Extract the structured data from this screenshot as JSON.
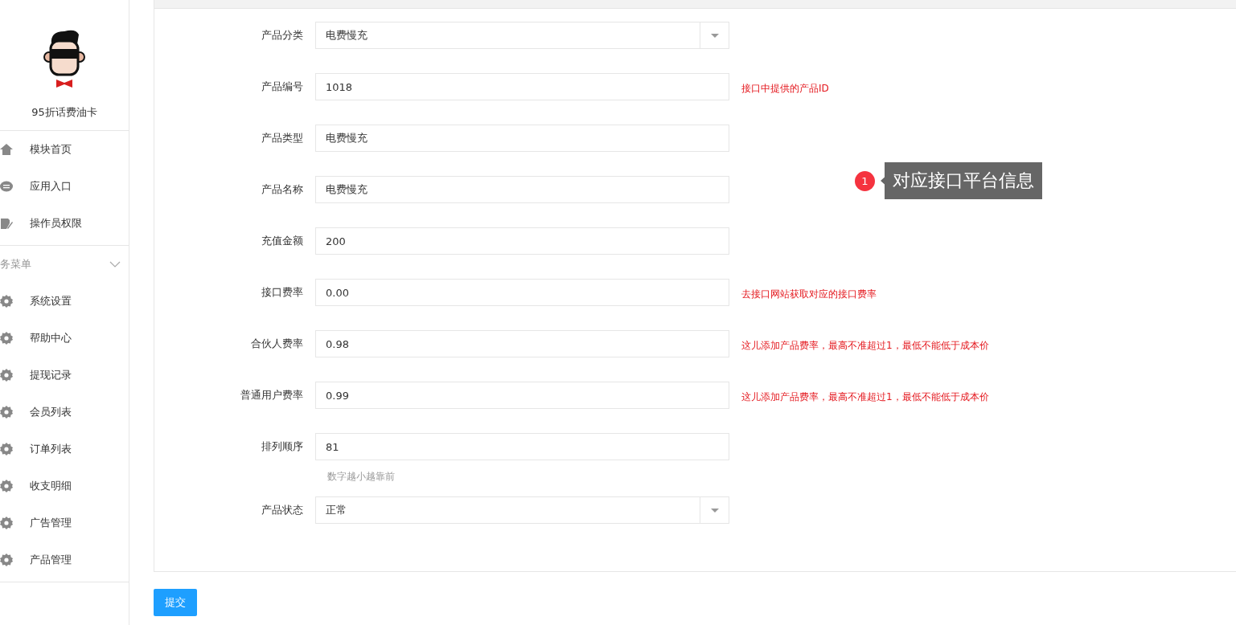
{
  "sidebar": {
    "brand": "95折话费油卡",
    "items": [
      {
        "label": "模块首页",
        "kind": "home"
      },
      {
        "label": "应用入口",
        "kind": "chat"
      },
      {
        "label": "操作员权限",
        "kind": "edit"
      }
    ],
    "section": {
      "label": "务菜单",
      "expanded": true
    },
    "section_items": [
      {
        "label": "系统设置"
      },
      {
        "label": "帮助中心"
      },
      {
        "label": "提现记录"
      },
      {
        "label": "会员列表"
      },
      {
        "label": "订单列表"
      },
      {
        "label": "收支明细"
      },
      {
        "label": "广告管理"
      },
      {
        "label": "产品管理"
      }
    ]
  },
  "form": {
    "fields": [
      {
        "label": "产品分类",
        "kind": "select",
        "value": "电费慢充"
      },
      {
        "label": "产品编号",
        "kind": "input",
        "value": "1018",
        "hint": "接口中提供的产品ID"
      },
      {
        "label": "产品类型",
        "kind": "input",
        "value": "电费慢充"
      },
      {
        "label": "产品名称",
        "kind": "input",
        "value": "电费慢充"
      },
      {
        "label": "充值金额",
        "kind": "input",
        "value": "200"
      },
      {
        "label": "接口费率",
        "kind": "input",
        "value": "0.00",
        "hint": "去接口网站获取对应的接口费率"
      },
      {
        "label": "合伙人费率",
        "kind": "input",
        "value": "0.98",
        "hint": "这儿添加产品费率，最高不准超过1，最低不能低于成本价"
      },
      {
        "label": "普通用户费率",
        "kind": "input",
        "value": "0.99",
        "hint": "这儿添加产品费率，最高不准超过1，最低不能低于成本价"
      },
      {
        "label": "排列顺序",
        "kind": "input",
        "value": "81",
        "help": "数字越小越靠前"
      },
      {
        "label": "产品状态",
        "kind": "select",
        "value": "正常"
      }
    ],
    "annotation": {
      "badge": "1",
      "text": "对应接口平台信息"
    }
  },
  "submit": "提交"
}
